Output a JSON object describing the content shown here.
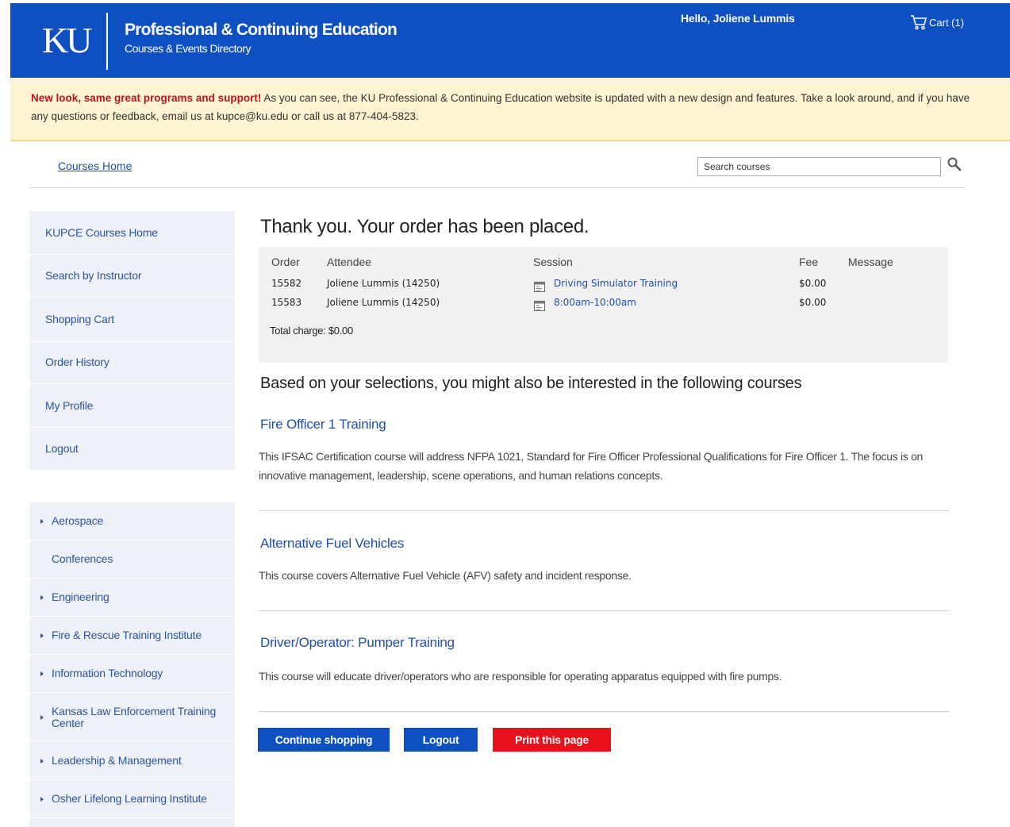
{
  "header": {
    "logo": "KU",
    "title": "Professional & Continuing Education",
    "subtitle": "Courses & Events Directory",
    "greeting": "Hello, Joliene Lummis",
    "cart_label": "Cart (1)"
  },
  "announcement": {
    "highlight": "New look, same great programs and support!",
    "text": " As you can see, the KU Professional & Continuing Education website is updated with a new design and features. Take a look around, and if you have any questions or feedback, email us at kupce@ku.edu or call us at 877-404-5823."
  },
  "breadcrumb": "Courses Home",
  "search": {
    "placeholder": "Search courses"
  },
  "nav_account": [
    "KUPCE Courses Home",
    "Search by Instructor",
    "Shopping Cart",
    "Order History",
    "My Profile",
    "Logout"
  ],
  "nav_categories": [
    {
      "label": "Aerospace",
      "arrow": true
    },
    {
      "label": "Conferences",
      "arrow": false
    },
    {
      "label": "Engineering",
      "arrow": true
    },
    {
      "label": "Fire & Rescue Training Institute",
      "arrow": true
    },
    {
      "label": "Information Technology",
      "arrow": true
    },
    {
      "label": "Kansas Law Enforcement Training Center",
      "arrow": true
    },
    {
      "label": "Leadership & Management",
      "arrow": true
    },
    {
      "label": "Osher Lifelong Learning Institute",
      "arrow": true
    }
  ],
  "confirmation": {
    "title": "Thank you. Your order has been placed.",
    "headers": {
      "order": "Order",
      "attendee": "Attendee",
      "session": "Session",
      "fee": "Fee",
      "message": "Message"
    },
    "rows": [
      {
        "order": "15582",
        "attendee": "Joliene Lummis (14250)",
        "session": "Driving Simulator Training",
        "fee": "$0.00",
        "message": ""
      },
      {
        "order": "15583",
        "attendee": "Joliene Lummis (14250)",
        "session": "8:00am-10:00am",
        "fee": "$0.00",
        "message": ""
      }
    ],
    "total": "Total charge: $0.00"
  },
  "recommendations": {
    "heading": "Based on your selections, you might also be interested in the following courses",
    "courses": [
      {
        "title": "Fire Officer 1 Training",
        "description": "This IFSAC Certification course will address NFPA 1021, Standard for Fire Officer Professional Qualifications for Fire Officer 1. The focus is on innovative management, leadership, scene operations, and human relations concepts."
      },
      {
        "title": "Alternative Fuel Vehicles",
        "description": "This course covers Alternative Fuel Vehicle (AFV) safety and incident response."
      },
      {
        "title": "Driver/Operator: Pumper Training",
        "description": "This course will educate driver/operators who are responsible for operating apparatus equipped with fire pumps."
      }
    ]
  },
  "buttons": {
    "continue": "Continue shopping",
    "logout": "Logout",
    "print": "Print this page"
  },
  "colors": {
    "brand_blue": "#0e4fc2",
    "print_red": "#e8111b",
    "announcement_bg": "#fdf3d3",
    "link": "#1f4fa6"
  }
}
